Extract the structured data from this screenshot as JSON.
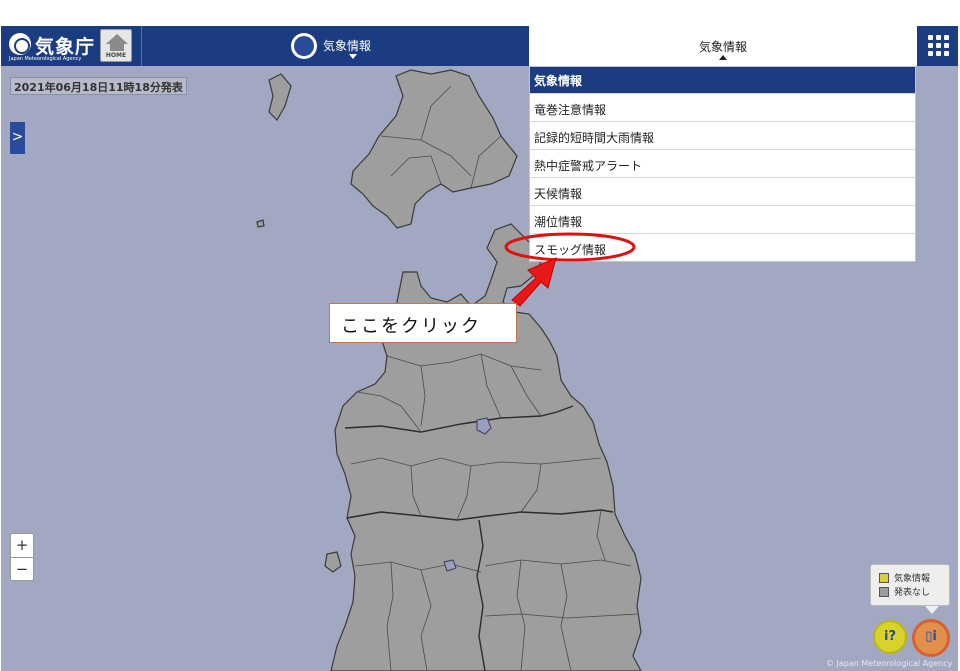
{
  "header": {
    "logo_text": "気象庁",
    "logo_subtext": "Japan Meteorological Agency",
    "home_label": "HOME",
    "nav_left_label": "気象情報",
    "nav_right_label": "気象情報"
  },
  "dropdown": {
    "header": "気象情報",
    "items": [
      {
        "label": "竜巻注意情報"
      },
      {
        "label": "記録的短時間大雨情報"
      },
      {
        "label": "熱中症警戒アラート"
      },
      {
        "label": "天候情報"
      },
      {
        "label": "潮位情報"
      },
      {
        "label": "スモッグ情報"
      }
    ]
  },
  "map": {
    "timestamp": "2021年06月18日11時18分発表",
    "zoom_in": "+",
    "zoom_out": "−",
    "sidebar_toggle": ">",
    "legend": [
      {
        "label": "気象情報",
        "color": "#d8cf3a"
      },
      {
        "label": "発表なし",
        "color": "#9e9e9e"
      }
    ],
    "copyright": "© Japan Meteorological Agency"
  },
  "annotation": {
    "callout_text": "ここをクリック",
    "highlight_color": "#e01010"
  },
  "icons": {
    "logo": "jma-logo-icon",
    "home": "home-icon",
    "weather_info": "weather-info-icon",
    "grid_menu": "grid-menu-icon",
    "person_info": "person-info-icon",
    "book_info": "book-info-icon"
  }
}
